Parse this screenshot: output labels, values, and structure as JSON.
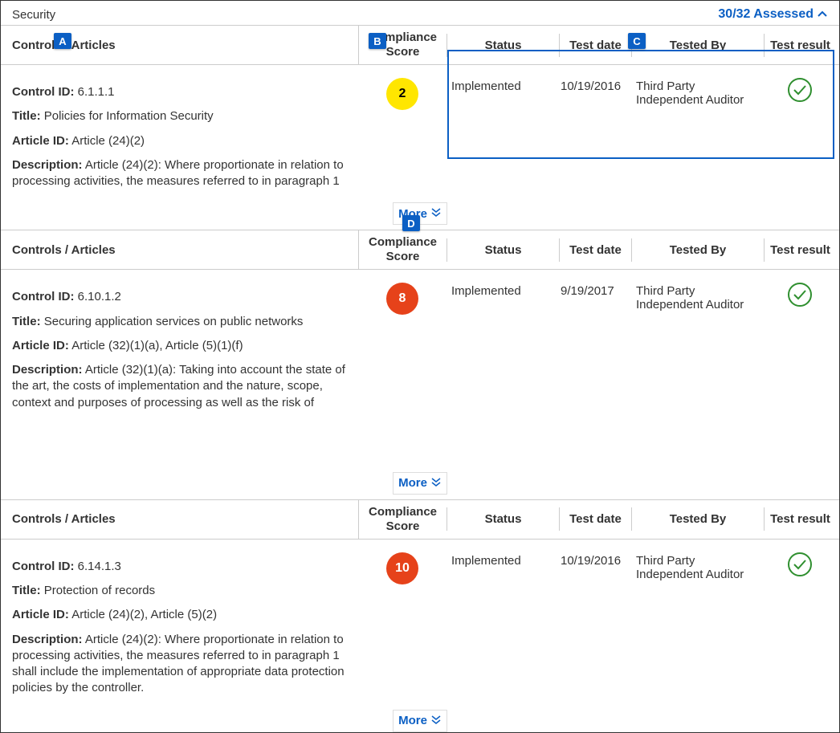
{
  "section_title": "Security",
  "assessed_summary": "30/32 Assessed",
  "callouts": {
    "A": "A",
    "B": "B",
    "C": "C",
    "D": "D"
  },
  "headers": {
    "controls": "Controls / Articles",
    "score": "Compliance Score",
    "status": "Status",
    "testdate": "Test date",
    "testedby": "Tested By",
    "result": "Test result"
  },
  "more_label": "More",
  "rows": [
    {
      "control_id_label": "Control ID:",
      "control_id": "6.1.1.1",
      "title_label": "Title:",
      "title": "Policies for Information Security",
      "article_label": "Article ID:",
      "article": "Article (24)(2)",
      "desc_label": "Description:",
      "desc": "Article (24)(2): Where proportionate in relation to processing activities, the measures referred to in paragraph 1",
      "score": "2",
      "score_color": "yellow",
      "status": "Implemented",
      "testdate": "10/19/2016",
      "testedby": "Third Party Independent Auditor",
      "result": "pass"
    },
    {
      "control_id_label": "Control ID:",
      "control_id": "6.10.1.2",
      "title_label": "Title:",
      "title": "Securing application services on public networks",
      "article_label": "Article ID:",
      "article": "Article (32)(1)(a), Article (5)(1)(f)",
      "desc_label": "Description:",
      "desc": "Article (32)(1)(a): Taking into account the state of the art, the costs of implementation and the nature, scope, context and purposes of processing as well as the risk of",
      "score": "8",
      "score_color": "red",
      "status": "Implemented",
      "testdate": "9/19/2017",
      "testedby": "Third Party Independent Auditor",
      "result": "pass"
    },
    {
      "control_id_label": "Control ID:",
      "control_id": "6.14.1.3",
      "title_label": "Title:",
      "title": "Protection of records",
      "article_label": "Article ID:",
      "article": "Article (24)(2), Article (5)(2)",
      "desc_label": "Description:",
      "desc": "Article (24)(2): Where proportionate in relation to processing activities, the measures referred to in paragraph 1 shall include the implementation of appropriate data protection policies by the controller.",
      "score": "10",
      "score_color": "red",
      "status": "Implemented",
      "testdate": "10/19/2016",
      "testedby": "Third Party Independent Auditor",
      "result": "pass"
    }
  ]
}
